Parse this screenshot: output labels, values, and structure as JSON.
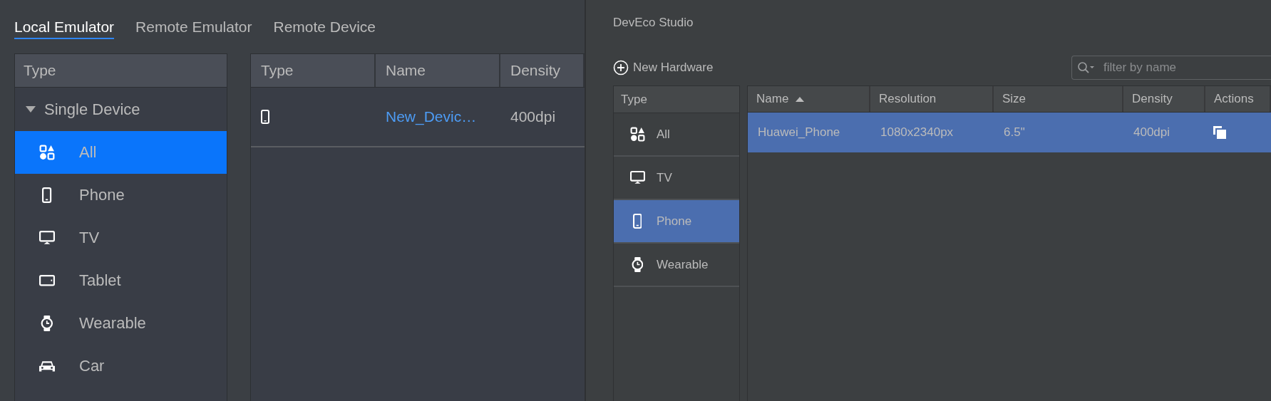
{
  "device_manager": {
    "tabs": [
      {
        "label": "Local Emulator",
        "selected": true
      },
      {
        "label": "Remote Emulator",
        "selected": false
      },
      {
        "label": "Remote Device",
        "selected": false
      }
    ],
    "type_tree": {
      "header": "Type",
      "groups": [
        {
          "label": "Single Device",
          "expanded": true,
          "children": [
            {
              "label": "All",
              "kind": "all",
              "selected": true
            },
            {
              "label": "Phone",
              "kind": "phone",
              "selected": false
            },
            {
              "label": "TV",
              "kind": "tv",
              "selected": false
            },
            {
              "label": "Tablet",
              "kind": "tablet",
              "selected": false
            },
            {
              "label": "Wearable",
              "kind": "wearable",
              "selected": false
            },
            {
              "label": "Car",
              "kind": "car",
              "selected": false
            }
          ]
        }
      ]
    },
    "device_table": {
      "columns": [
        "Type",
        "Name",
        "Density"
      ],
      "rows": [
        {
          "kind": "phone",
          "name": "New_Devic…",
          "density": "400dpi"
        }
      ]
    }
  },
  "select_hardware": {
    "subtitle": "DevEco Studio",
    "new_button": "New Hardware",
    "filter": {
      "placeholder": "filter by name"
    },
    "type_list": {
      "header": "Type",
      "items": [
        {
          "label": "All",
          "kind": "all",
          "selected": false
        },
        {
          "label": "TV",
          "kind": "tv",
          "selected": false
        },
        {
          "label": "Phone",
          "kind": "phone",
          "selected": true
        },
        {
          "label": "Wearable",
          "kind": "wearable",
          "selected": false
        }
      ]
    },
    "table": {
      "columns": [
        {
          "label": "Name",
          "sorted": true
        },
        {
          "label": "Resolution",
          "sorted": false
        },
        {
          "label": "Size",
          "sorted": false
        },
        {
          "label": "Density",
          "sorted": false
        },
        {
          "label": "Actions",
          "sorted": false
        }
      ],
      "rows": [
        {
          "cells": [
            "Huawei_Phone",
            "1080x2340px",
            "6.5\"",
            "400dpi"
          ],
          "selected": true
        }
      ]
    }
  }
}
